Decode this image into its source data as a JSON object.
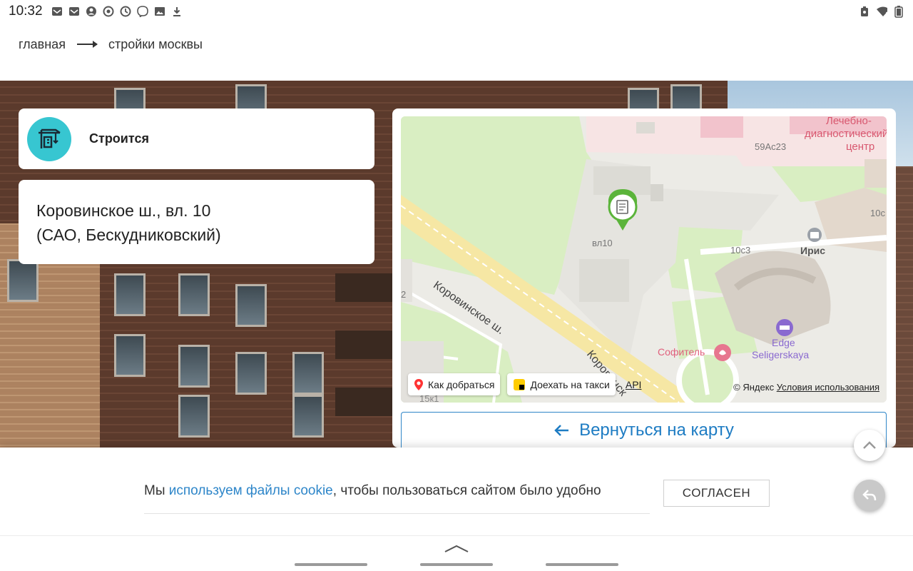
{
  "status_bar": {
    "time": "10:32",
    "notification_icons": [
      "mail-icon",
      "mail-icon",
      "account-icon",
      "sync-icon",
      "sync-icon",
      "viber-icon",
      "image-icon",
      "download-icon"
    ],
    "right_icons": [
      "battery-lock-icon",
      "wifi-icon",
      "battery-icon"
    ]
  },
  "breadcrumb": {
    "home": "главная",
    "current": "стройки москвы"
  },
  "status_card": {
    "label": "Строится",
    "icon": "construction-crane-icon",
    "icon_bg": "#37c6d1"
  },
  "address": {
    "line1": "Коровинское ш., вл. 10",
    "line2": "(САО, Бескудниковский)"
  },
  "map": {
    "labels": {
      "street": "Коровинское ш.",
      "street2": "Коровинск",
      "marker": "вл10",
      "medical1": "Лечебно-",
      "medical2": "диагностический",
      "medical3": "центр",
      "house_59": "59Ас23",
      "house_10c": "10с",
      "house_10c3": "10с3",
      "iris": "Ирис",
      "edge1": "Edge",
      "edge2": "Seligerskaya",
      "sofitel": "Софитель",
      "house_15": "15к1",
      "left_2": "2"
    },
    "buttons": {
      "route": "Как добраться",
      "taxi": "Доехать на такси",
      "api": "API"
    },
    "copyright": "© Яндекс",
    "terms": "Условия использования"
  },
  "back_button": "Вернуться на карту",
  "cookie": {
    "prefix": "Мы ",
    "link": "используем файлы cookie",
    "suffix": ", чтобы пользоваться сайтом было удобно",
    "accept": "СОГЛАСЕН"
  },
  "colors": {
    "accent": "#2e86c9",
    "status_teal": "#37c6d1",
    "marker_green": "#5bb43a",
    "road_yellow": "#f6e7a4",
    "park_green": "#d9eec2"
  }
}
